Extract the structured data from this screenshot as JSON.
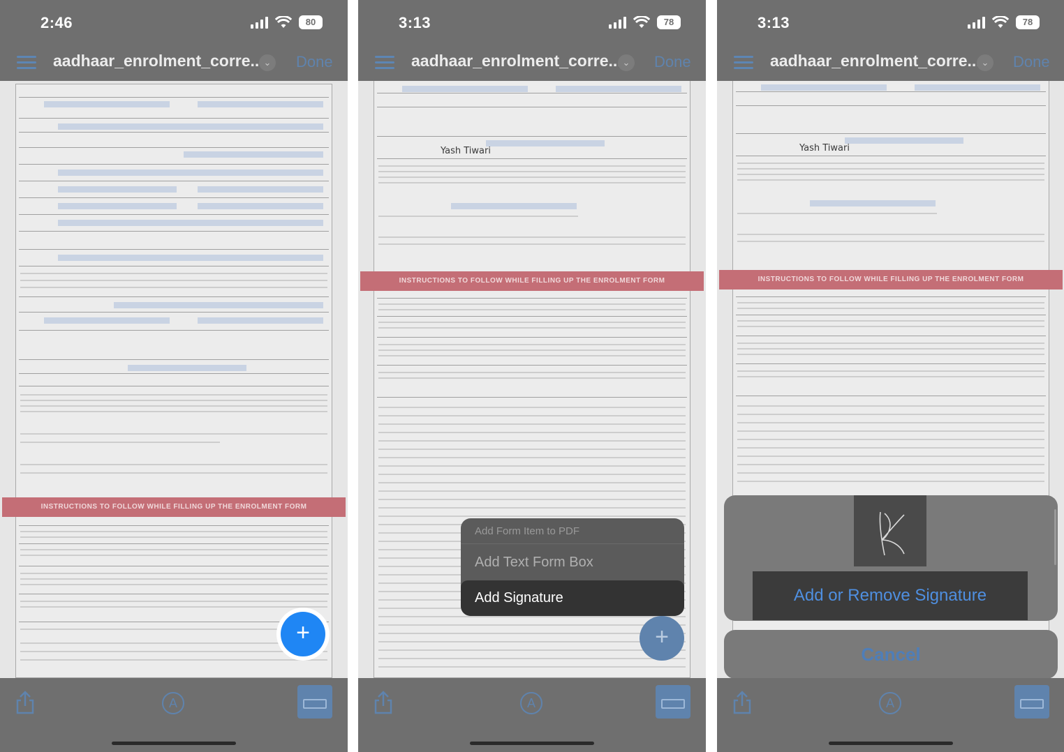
{
  "panels": [
    {
      "status_time": "2:46",
      "battery": "80",
      "doc_title": "aadhaar_enrolment_corre...",
      "done_label": "Done",
      "instructions_banner": "INSTRUCTIONS TO FOLLOW WHILE FILLING UP THE ENROLMENT FORM",
      "fab_symbol": "+"
    },
    {
      "status_time": "3:13",
      "battery": "78",
      "doc_title": "aadhaar_enrolment_corre...",
      "done_label": "Done",
      "introducer_name": "Yash Tiwari",
      "instructions_banner": "INSTRUCTIONS TO FOLLOW WHILE FILLING UP THE ENROLMENT FORM",
      "menu": {
        "header": "Add Form Item to PDF",
        "items": [
          "Add Text Form Box",
          "Add Signature"
        ]
      },
      "fab_symbol": "+"
    },
    {
      "status_time": "3:13",
      "battery": "78",
      "doc_title": "aadhaar_enrolment_corre...",
      "done_label": "Done",
      "introducer_name": "Yash Tiwari",
      "instructions_banner": "INSTRUCTIONS TO FOLLOW WHILE FILLING UP THE ENROLMENT FORM",
      "sheet_action": "Add or Remove Signature",
      "cancel_label": "Cancel"
    }
  ],
  "icons": {
    "list": "list-icon",
    "chevron": "chevron-down-icon",
    "share": "share-icon",
    "markup": "markup-icon",
    "form": "form-fill-icon",
    "add": "plus-icon"
  },
  "colors": {
    "fab_blue": "#1f86f4",
    "link_blue": "#4f8fe0",
    "dim_overlay": "#6f6f6f",
    "banner_red": "#c46e76"
  }
}
